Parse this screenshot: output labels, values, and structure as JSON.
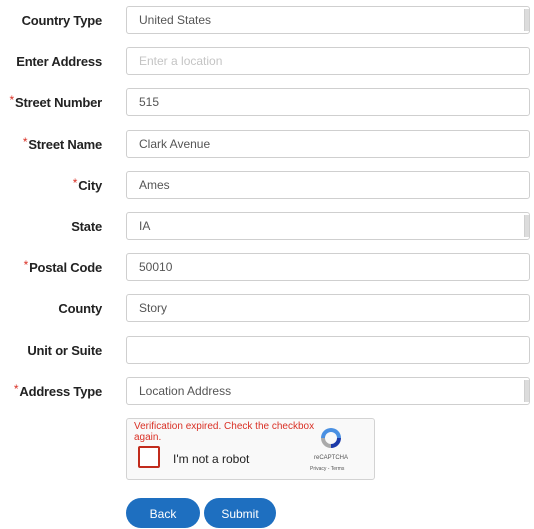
{
  "form": {
    "fields": [
      {
        "label": "Country Type",
        "required": false,
        "value": "United States",
        "placeholder": "",
        "kind": "select"
      },
      {
        "label": "Enter Address",
        "required": false,
        "value": "",
        "placeholder": "Enter a location",
        "kind": "text"
      },
      {
        "label": "Street Number",
        "required": true,
        "value": "515",
        "placeholder": "",
        "kind": "text"
      },
      {
        "label": "Street Name",
        "required": true,
        "value": "Clark Avenue",
        "placeholder": "",
        "kind": "text"
      },
      {
        "label": "City",
        "required": true,
        "value": "Ames",
        "placeholder": "",
        "kind": "text"
      },
      {
        "label": "State",
        "required": false,
        "value": "IA",
        "placeholder": "",
        "kind": "select"
      },
      {
        "label": "Postal Code",
        "required": true,
        "value": "50010",
        "placeholder": "",
        "kind": "text"
      },
      {
        "label": "County",
        "required": false,
        "value": "Story",
        "placeholder": "",
        "kind": "text"
      },
      {
        "label": "Unit or Suite",
        "required": false,
        "value": "",
        "placeholder": "",
        "kind": "text"
      },
      {
        "label": "Address Type",
        "required": true,
        "value": "Location Address",
        "placeholder": "",
        "kind": "select"
      }
    ],
    "required_marker": "*"
  },
  "recaptcha": {
    "error": "Verification expired. Check the checkbox again.",
    "checkbox_label": "I'm not a robot",
    "brand": "reCAPTCHA",
    "terms": "Privacy - Terms"
  },
  "buttons": {
    "back": "Back",
    "submit": "Submit"
  },
  "colors": {
    "required": "#d93025",
    "button": "#1e6fc0",
    "recaptcha_error": "#d93025"
  }
}
